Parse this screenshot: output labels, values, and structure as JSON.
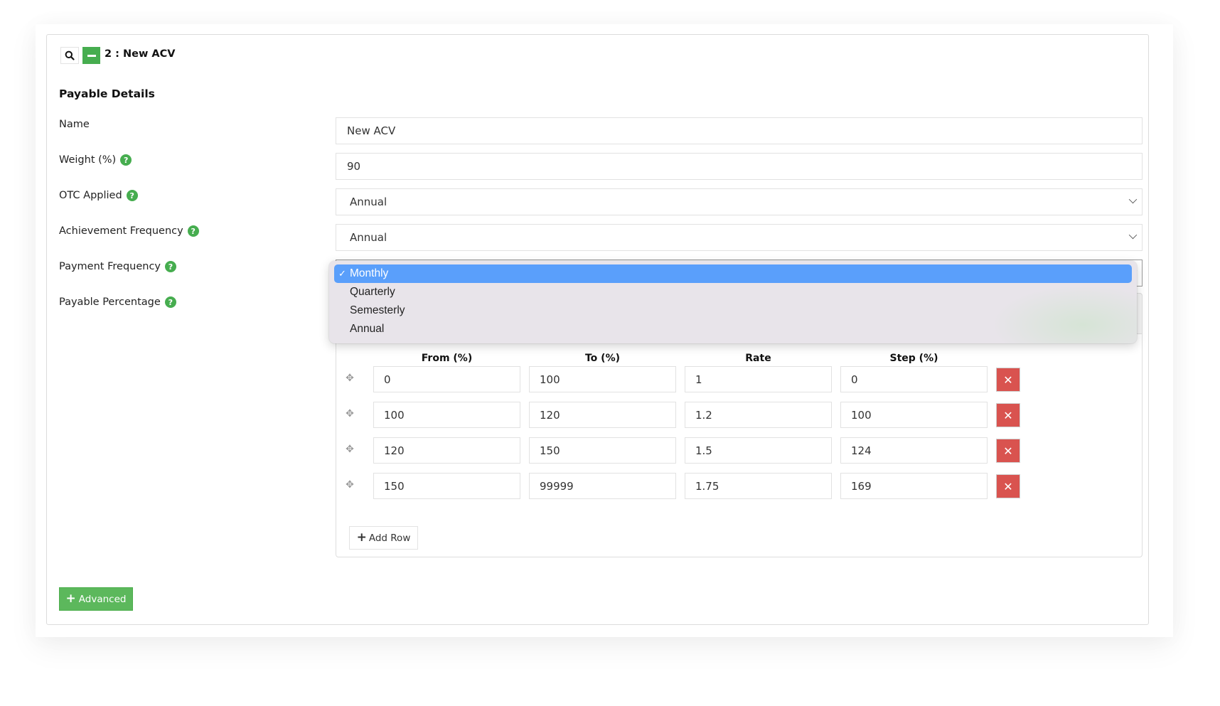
{
  "header": {
    "title": "2 : New ACV",
    "search_icon": "search-icon",
    "collapse_icon": "minus-icon"
  },
  "section": {
    "title": "Payable Details"
  },
  "form": {
    "name": {
      "label": "Name",
      "value": "New ACV"
    },
    "weight": {
      "label": "Weight (%)",
      "value": "90",
      "help": "?"
    },
    "otc_applied": {
      "label": "OTC Applied",
      "value": "Annual",
      "help": "?"
    },
    "achievement_frequency": {
      "label": "Achievement Frequency",
      "value": "Annual",
      "help": "?"
    },
    "payment_frequency": {
      "label": "Payment Frequency",
      "value": "Monthly",
      "help": "?"
    },
    "payable_percentage": {
      "label": "Payable Percentage",
      "help": "?"
    }
  },
  "dropdown": {
    "check": "✓",
    "options": [
      {
        "label": "Monthly",
        "selected": true
      },
      {
        "label": "Quarterly",
        "selected": false
      },
      {
        "label": "Semesterly",
        "selected": false
      },
      {
        "label": "Annual",
        "selected": false
      }
    ]
  },
  "tiers": {
    "columns": [
      "From (%)",
      "To (%)",
      "Rate",
      "Step (%)"
    ],
    "rows": [
      [
        "0",
        "100",
        "1",
        "0"
      ],
      [
        "100",
        "120",
        "1.2",
        "100"
      ],
      [
        "120",
        "150",
        "1.5",
        "124"
      ],
      [
        "150",
        "99999",
        "1.75",
        "169"
      ]
    ],
    "move_glyph": "✥",
    "delete_glyph": "✕",
    "add_row_label": "Add Row",
    "plus_glyph": "+"
  },
  "advanced_label": "Advanced",
  "colors": {
    "green": "#5cb85c",
    "danger": "#d9534f",
    "selection_blue": "#5a9ffb"
  }
}
